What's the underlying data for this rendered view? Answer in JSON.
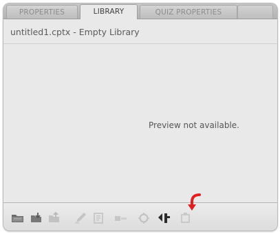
{
  "tabs": {
    "properties": "PROPERTIES",
    "library": "LIBRARY",
    "quiz_properties": "QUIZ PROPERTIES"
  },
  "library": {
    "title_line": "untitled1.cptx - Empty Library",
    "preview_message": "Preview not available."
  },
  "toolbar_icons": [
    "open-library-icon",
    "import-icon",
    "export-icon",
    "edit-icon",
    "properties-icon",
    "usage-icon",
    "update-icon",
    "select-unused-icon",
    "delete-icon"
  ],
  "colors": {
    "panel_bg": "#e9e9e9",
    "highlight_arrow": "#e02020",
    "active_icon": "#2b2b2b",
    "disabled_icon": "#b8b8b8"
  }
}
